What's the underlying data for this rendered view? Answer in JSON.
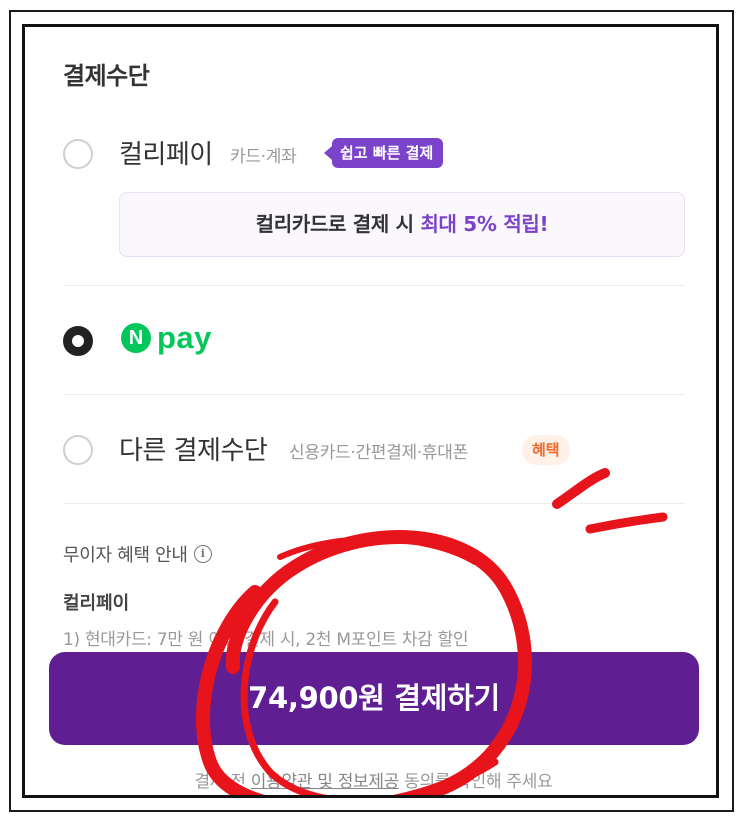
{
  "payment": {
    "section_title": "결제수단",
    "options": [
      {
        "label": "컬리페이",
        "sub": "카드·계좌",
        "badge": "쉽고 빠른 결제",
        "selected": false
      },
      {
        "label": "N pay",
        "selected": true
      },
      {
        "label": "다른 결제수단",
        "sub": "신용카드·간편결제·휴대폰",
        "badge": "혜택",
        "selected": false
      }
    ],
    "promo": {
      "prefix": "컬리카드로 결제 시 ",
      "highlight": "최대 5% 적립!"
    },
    "npay": {
      "n": "N",
      "text": "pay"
    }
  },
  "benefit": {
    "title": "무이자 혜택 안내",
    "subtitle": "컬리페이",
    "line": "1) 현대카드: 7만 원 이상 결제 시, 2천 M포인트 차감 할인"
  },
  "checkout": {
    "button_label": "74,900원 결제하기",
    "notice_prefix": "결제 전 ",
    "notice_link": "이용약관 및 정보제공",
    "notice_suffix": " 동의를 확인해 주세요"
  },
  "colors": {
    "brand_purple": "#5f1f92",
    "accent_purple": "#7b43c9",
    "naver_green": "#03c75a",
    "benefit_orange": "#f06a2a",
    "annotation_red": "#e8141b"
  }
}
